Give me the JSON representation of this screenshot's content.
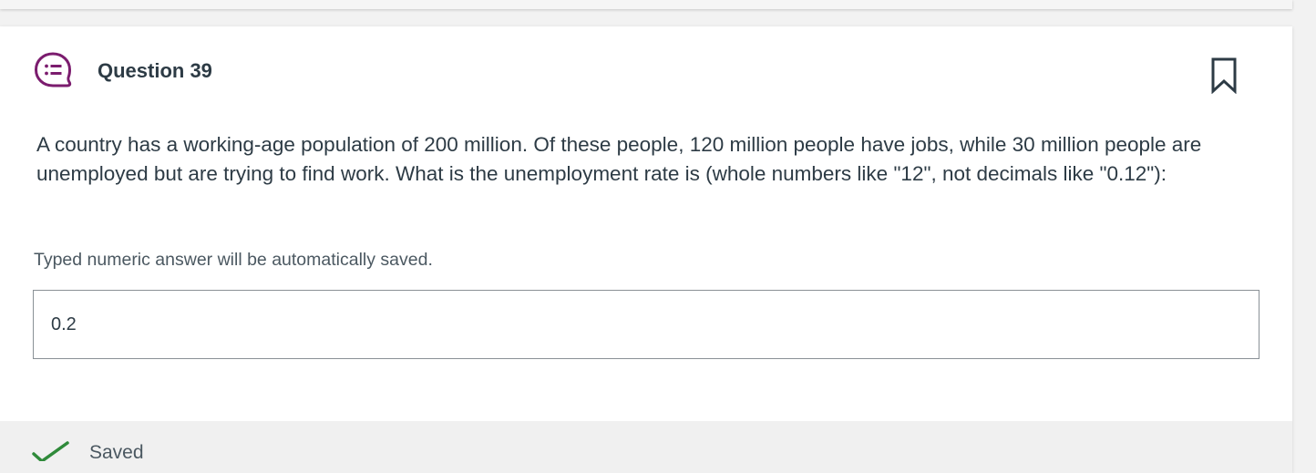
{
  "question": {
    "title": "Question 39",
    "text": "A country has a working-age population of 200 million. Of these people, 120 million people have jobs, while 30 million people are unemployed but are trying to find work. What is the unemployment rate is (whole numbers like \"12\", not decimals like \"0.12\"):",
    "hint": "Typed numeric answer will be automatically saved.",
    "answer_value": "0.2",
    "icon": "quiz-question-icon",
    "bookmark_icon": "bookmark-icon"
  },
  "status": {
    "saved_label": "Saved",
    "icon": "checkmark-icon"
  },
  "colors": {
    "accent_purple": "#7b1c6e",
    "success_green": "#2f8a3a",
    "text": "#2d3b45"
  }
}
